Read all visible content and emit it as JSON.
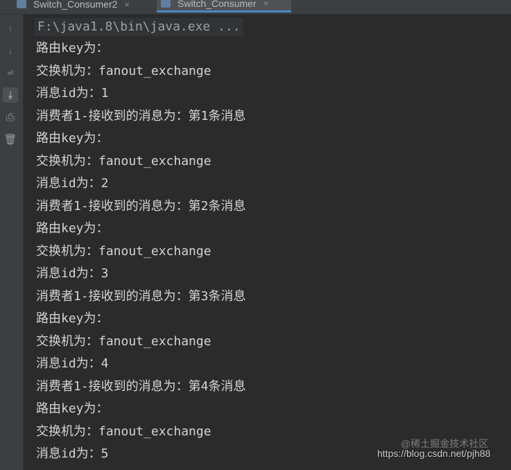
{
  "tabs": [
    {
      "label": "Switch_Consumer2",
      "close": "×"
    },
    {
      "label": "Switch_Consumer",
      "close": "×"
    }
  ],
  "toolbar": {
    "up_icon": "↑",
    "down_icon": "↓",
    "wrap_icon": "⏎",
    "scroll_end_icon": "⤓",
    "print_icon": "⎙",
    "trash_icon": "🗑"
  },
  "console": {
    "command": "F:\\java1.8\\bin\\java.exe ...",
    "lines": [
      "路由key为：",
      "交换机为：fanout_exchange",
      "消息id为：1",
      "消费者1-接收到的消息为：第1条消息",
      "路由key为：",
      "交换机为：fanout_exchange",
      "消息id为：2",
      "消费者1-接收到的消息为：第2条消息",
      "路由key为：",
      "交换机为：fanout_exchange",
      "消息id为：3",
      "消费者1-接收到的消息为：第3条消息",
      "路由key为：",
      "交换机为：fanout_exchange",
      "消息id为：4",
      "消费者1-接收到的消息为：第4条消息",
      "路由key为：",
      "交换机为：fanout_exchange",
      "消息id为：5"
    ]
  },
  "watermark": {
    "top": "@稀土掘金技术社区",
    "bottom": "https://blog.csdn.net/pjh88"
  }
}
